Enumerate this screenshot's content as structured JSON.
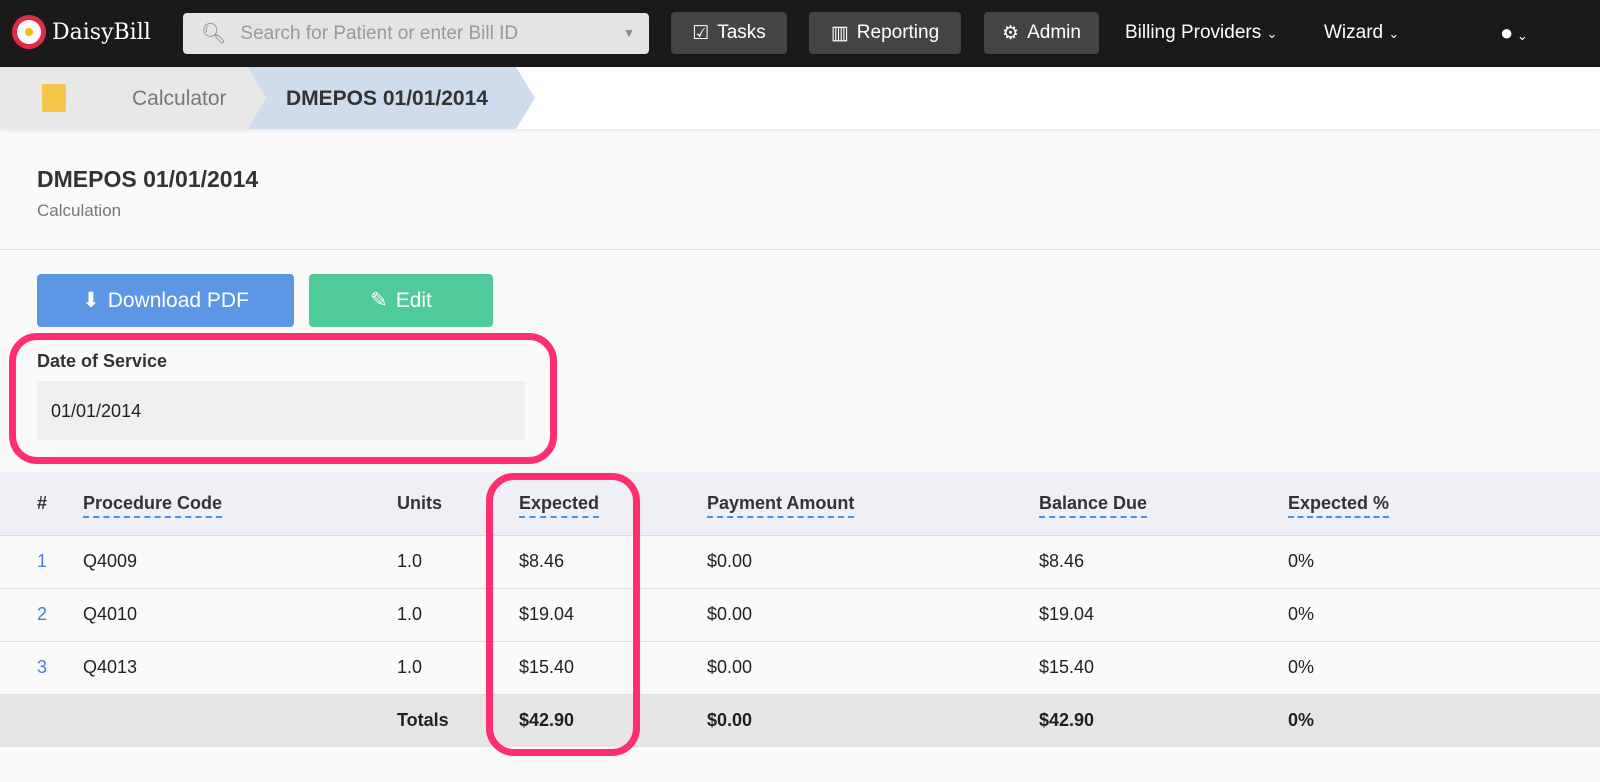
{
  "nav": {
    "brand": "DaisyBill",
    "search_placeholder": "Search for Patient or enter Bill ID",
    "tasks": "Tasks",
    "reporting": "Reporting",
    "admin": "Admin",
    "billing_providers": "Billing Providers",
    "wizard": "Wizard"
  },
  "breadcrumb": {
    "calculator": "Calculator",
    "current": "DMEPOS 01/01/2014"
  },
  "page": {
    "title": "DMEPOS 01/01/2014",
    "subtitle": "Calculation"
  },
  "actions": {
    "download": "Download PDF",
    "edit": "Edit"
  },
  "date_of_service": {
    "label": "Date of Service",
    "value": "01/01/2014"
  },
  "table": {
    "headers": [
      "#",
      "Procedure Code",
      "Units",
      "Expected",
      "Payment Amount",
      "Balance Due",
      "Expected %"
    ],
    "rows": [
      [
        "1",
        "Q4009",
        "1.0",
        "$8.46",
        "$0.00",
        "$8.46",
        "0%"
      ],
      [
        "2",
        "Q4010",
        "1.0",
        "$19.04",
        "$0.00",
        "$19.04",
        "0%"
      ],
      [
        "3",
        "Q4013",
        "1.0",
        "$15.40",
        "$0.00",
        "$15.40",
        "0%"
      ]
    ],
    "totals": {
      "label": "Totals",
      "expected": "$42.90",
      "payment": "$0.00",
      "balance": "$42.90",
      "percent": "0%"
    }
  },
  "colors": {
    "highlight": "#ff2e6e",
    "primary": "#5b97e5",
    "success": "#4fcb9a"
  }
}
